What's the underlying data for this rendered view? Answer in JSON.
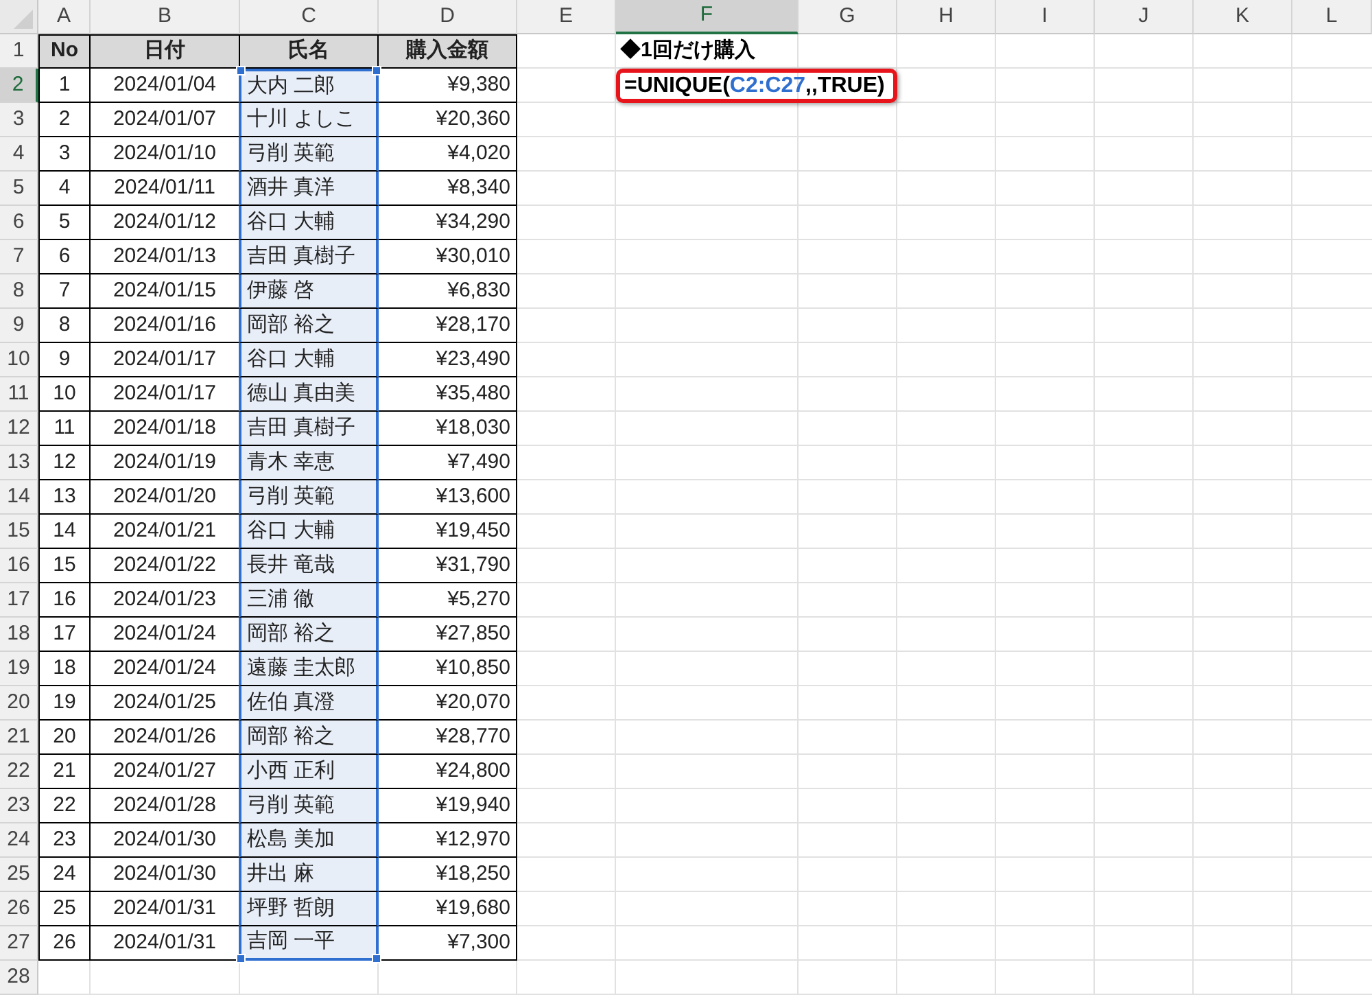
{
  "column_headers": [
    {
      "label": "A",
      "selected": false
    },
    {
      "label": "B",
      "selected": false
    },
    {
      "label": "C",
      "selected": false
    },
    {
      "label": "D",
      "selected": false
    },
    {
      "label": "E",
      "selected": false
    },
    {
      "label": "F",
      "selected": true
    },
    {
      "label": "G",
      "selected": false
    },
    {
      "label": "H",
      "selected": false
    },
    {
      "label": "I",
      "selected": false
    },
    {
      "label": "J",
      "selected": false
    },
    {
      "label": "K",
      "selected": false
    },
    {
      "label": "L",
      "selected": false
    }
  ],
  "row_headers": [
    {
      "label": "1",
      "selected": false
    },
    {
      "label": "2",
      "selected": true
    },
    {
      "label": "3",
      "selected": false
    },
    {
      "label": "4",
      "selected": false
    },
    {
      "label": "5",
      "selected": false
    },
    {
      "label": "6",
      "selected": false
    },
    {
      "label": "7",
      "selected": false
    },
    {
      "label": "8",
      "selected": false
    },
    {
      "label": "9",
      "selected": false
    },
    {
      "label": "10",
      "selected": false
    },
    {
      "label": "11",
      "selected": false
    },
    {
      "label": "12",
      "selected": false
    },
    {
      "label": "13",
      "selected": false
    },
    {
      "label": "14",
      "selected": false
    },
    {
      "label": "15",
      "selected": false
    },
    {
      "label": "16",
      "selected": false
    },
    {
      "label": "17",
      "selected": false
    },
    {
      "label": "18",
      "selected": false
    },
    {
      "label": "19",
      "selected": false
    },
    {
      "label": "20",
      "selected": false
    },
    {
      "label": "21",
      "selected": false
    },
    {
      "label": "22",
      "selected": false
    },
    {
      "label": "23",
      "selected": false
    },
    {
      "label": "24",
      "selected": false
    },
    {
      "label": "25",
      "selected": false
    },
    {
      "label": "26",
      "selected": false
    },
    {
      "label": "27",
      "selected": false
    },
    {
      "label": "28",
      "selected": false
    }
  ],
  "table": {
    "columns": [
      {
        "label": "No",
        "highlighted": false
      },
      {
        "label": "日付",
        "highlighted": false
      },
      {
        "label": "氏名",
        "highlighted": true
      },
      {
        "label": "購入金額",
        "highlighted": false
      }
    ],
    "rows": [
      [
        "1",
        "2024/01/04",
        "大内 二郎",
        "¥9,380"
      ],
      [
        "2",
        "2024/01/07",
        "十川 よしこ",
        "¥20,360"
      ],
      [
        "3",
        "2024/01/10",
        "弓削 英範",
        "¥4,020"
      ],
      [
        "4",
        "2024/01/11",
        "酒井 真洋",
        "¥8,340"
      ],
      [
        "5",
        "2024/01/12",
        "谷口 大輔",
        "¥34,290"
      ],
      [
        "6",
        "2024/01/13",
        "吉田 真樹子",
        "¥30,010"
      ],
      [
        "7",
        "2024/01/15",
        "伊藤 啓",
        "¥6,830"
      ],
      [
        "8",
        "2024/01/16",
        "岡部 裕之",
        "¥28,170"
      ],
      [
        "9",
        "2024/01/17",
        "谷口 大輔",
        "¥23,490"
      ],
      [
        "10",
        "2024/01/17",
        "徳山 真由美",
        "¥35,480"
      ],
      [
        "11",
        "2024/01/18",
        "吉田 真樹子",
        "¥18,030"
      ],
      [
        "12",
        "2024/01/19",
        "青木 幸恵",
        "¥7,490"
      ],
      [
        "13",
        "2024/01/20",
        "弓削 英範",
        "¥13,600"
      ],
      [
        "14",
        "2024/01/21",
        "谷口 大輔",
        "¥19,450"
      ],
      [
        "15",
        "2024/01/22",
        "長井 竜哉",
        "¥31,790"
      ],
      [
        "16",
        "2024/01/23",
        "三浦 徹",
        "¥5,270"
      ],
      [
        "17",
        "2024/01/24",
        "岡部 裕之",
        "¥27,850"
      ],
      [
        "18",
        "2024/01/24",
        "遠藤 圭太郎",
        "¥10,850"
      ],
      [
        "19",
        "2024/01/25",
        "佐伯 真澄",
        "¥20,070"
      ],
      [
        "20",
        "2024/01/26",
        "岡部 裕之",
        "¥28,770"
      ],
      [
        "21",
        "2024/01/27",
        "小西 正利",
        "¥24,800"
      ],
      [
        "22",
        "2024/01/28",
        "弓削 英範",
        "¥19,940"
      ],
      [
        "23",
        "2024/01/30",
        "松島 美加",
        "¥12,970"
      ],
      [
        "24",
        "2024/01/30",
        "井出 麻",
        "¥18,250"
      ],
      [
        "25",
        "2024/01/31",
        "坪野 哲朗",
        "¥19,680"
      ],
      [
        "26",
        "2024/01/31",
        "吉岡 一平",
        "¥7,300"
      ]
    ]
  },
  "result_heading": "◆1回だけ購入",
  "formula": {
    "annotated": true,
    "parts": [
      {
        "kind": "plain",
        "text": "=UNIQUE("
      },
      {
        "kind": "reference",
        "text": "C2:C27"
      },
      {
        "kind": "plain",
        "text": ",,TRUE)"
      }
    ]
  }
}
